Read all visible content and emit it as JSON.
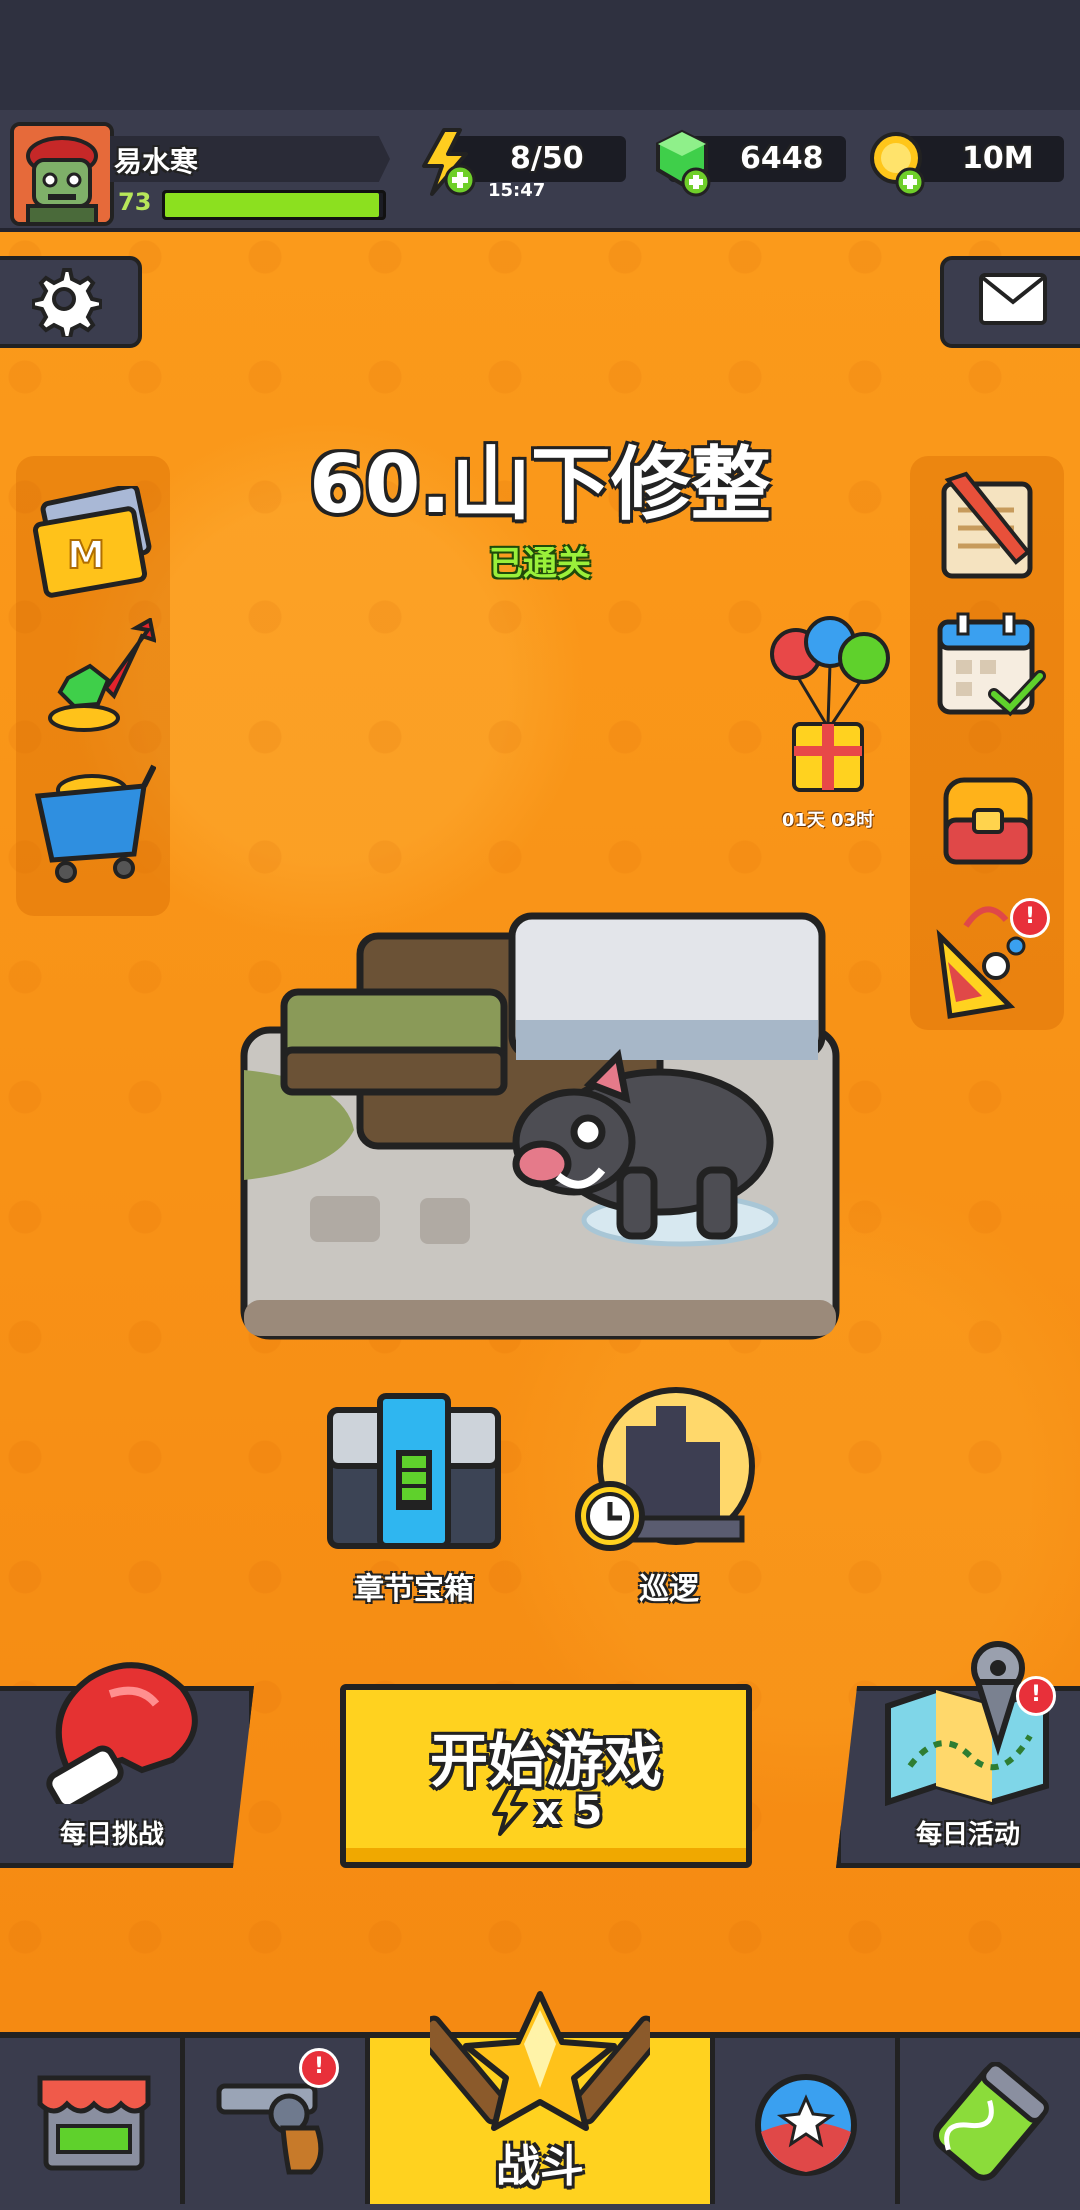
{
  "player": {
    "name": "易水寒",
    "level": "73",
    "xp_fraction": 0.98
  },
  "resources": {
    "energy": {
      "value": "8/50",
      "timer": "15:47",
      "icon": "lightning-plus-icon"
    },
    "gems": {
      "value": "6448",
      "icon": "gem-plus-icon"
    },
    "coins": {
      "value": "10M",
      "icon": "coin-plus-icon"
    }
  },
  "stage": {
    "title": "60.山下修整",
    "status": "已通关"
  },
  "left_icons": [
    "monthly-card-icon",
    "gem-upgrade-icon",
    "shop-cart-icon"
  ],
  "right_icons": [
    "quest-scroll-icon",
    "calendar-check-icon",
    "backpack-icon",
    "party-popper-icon"
  ],
  "event": {
    "timer": "01天 03时",
    "icon": "balloon-gift-icon"
  },
  "chapter_chest_label": "章节宝箱",
  "patrol_label": "巡逻",
  "daily_challenge_label": "每日挑战",
  "daily_event_label": "每日活动",
  "start_button": {
    "label": "开始游戏",
    "cost": "x 5"
  },
  "bottom_nav": {
    "battle_label": "战斗"
  },
  "colors": {
    "orange": "#f7931e",
    "yellow_button": "#ffd21f",
    "hud_bg": "#3a3c4d",
    "xp_green": "#8ce01f",
    "status_green": "#9af03a"
  }
}
